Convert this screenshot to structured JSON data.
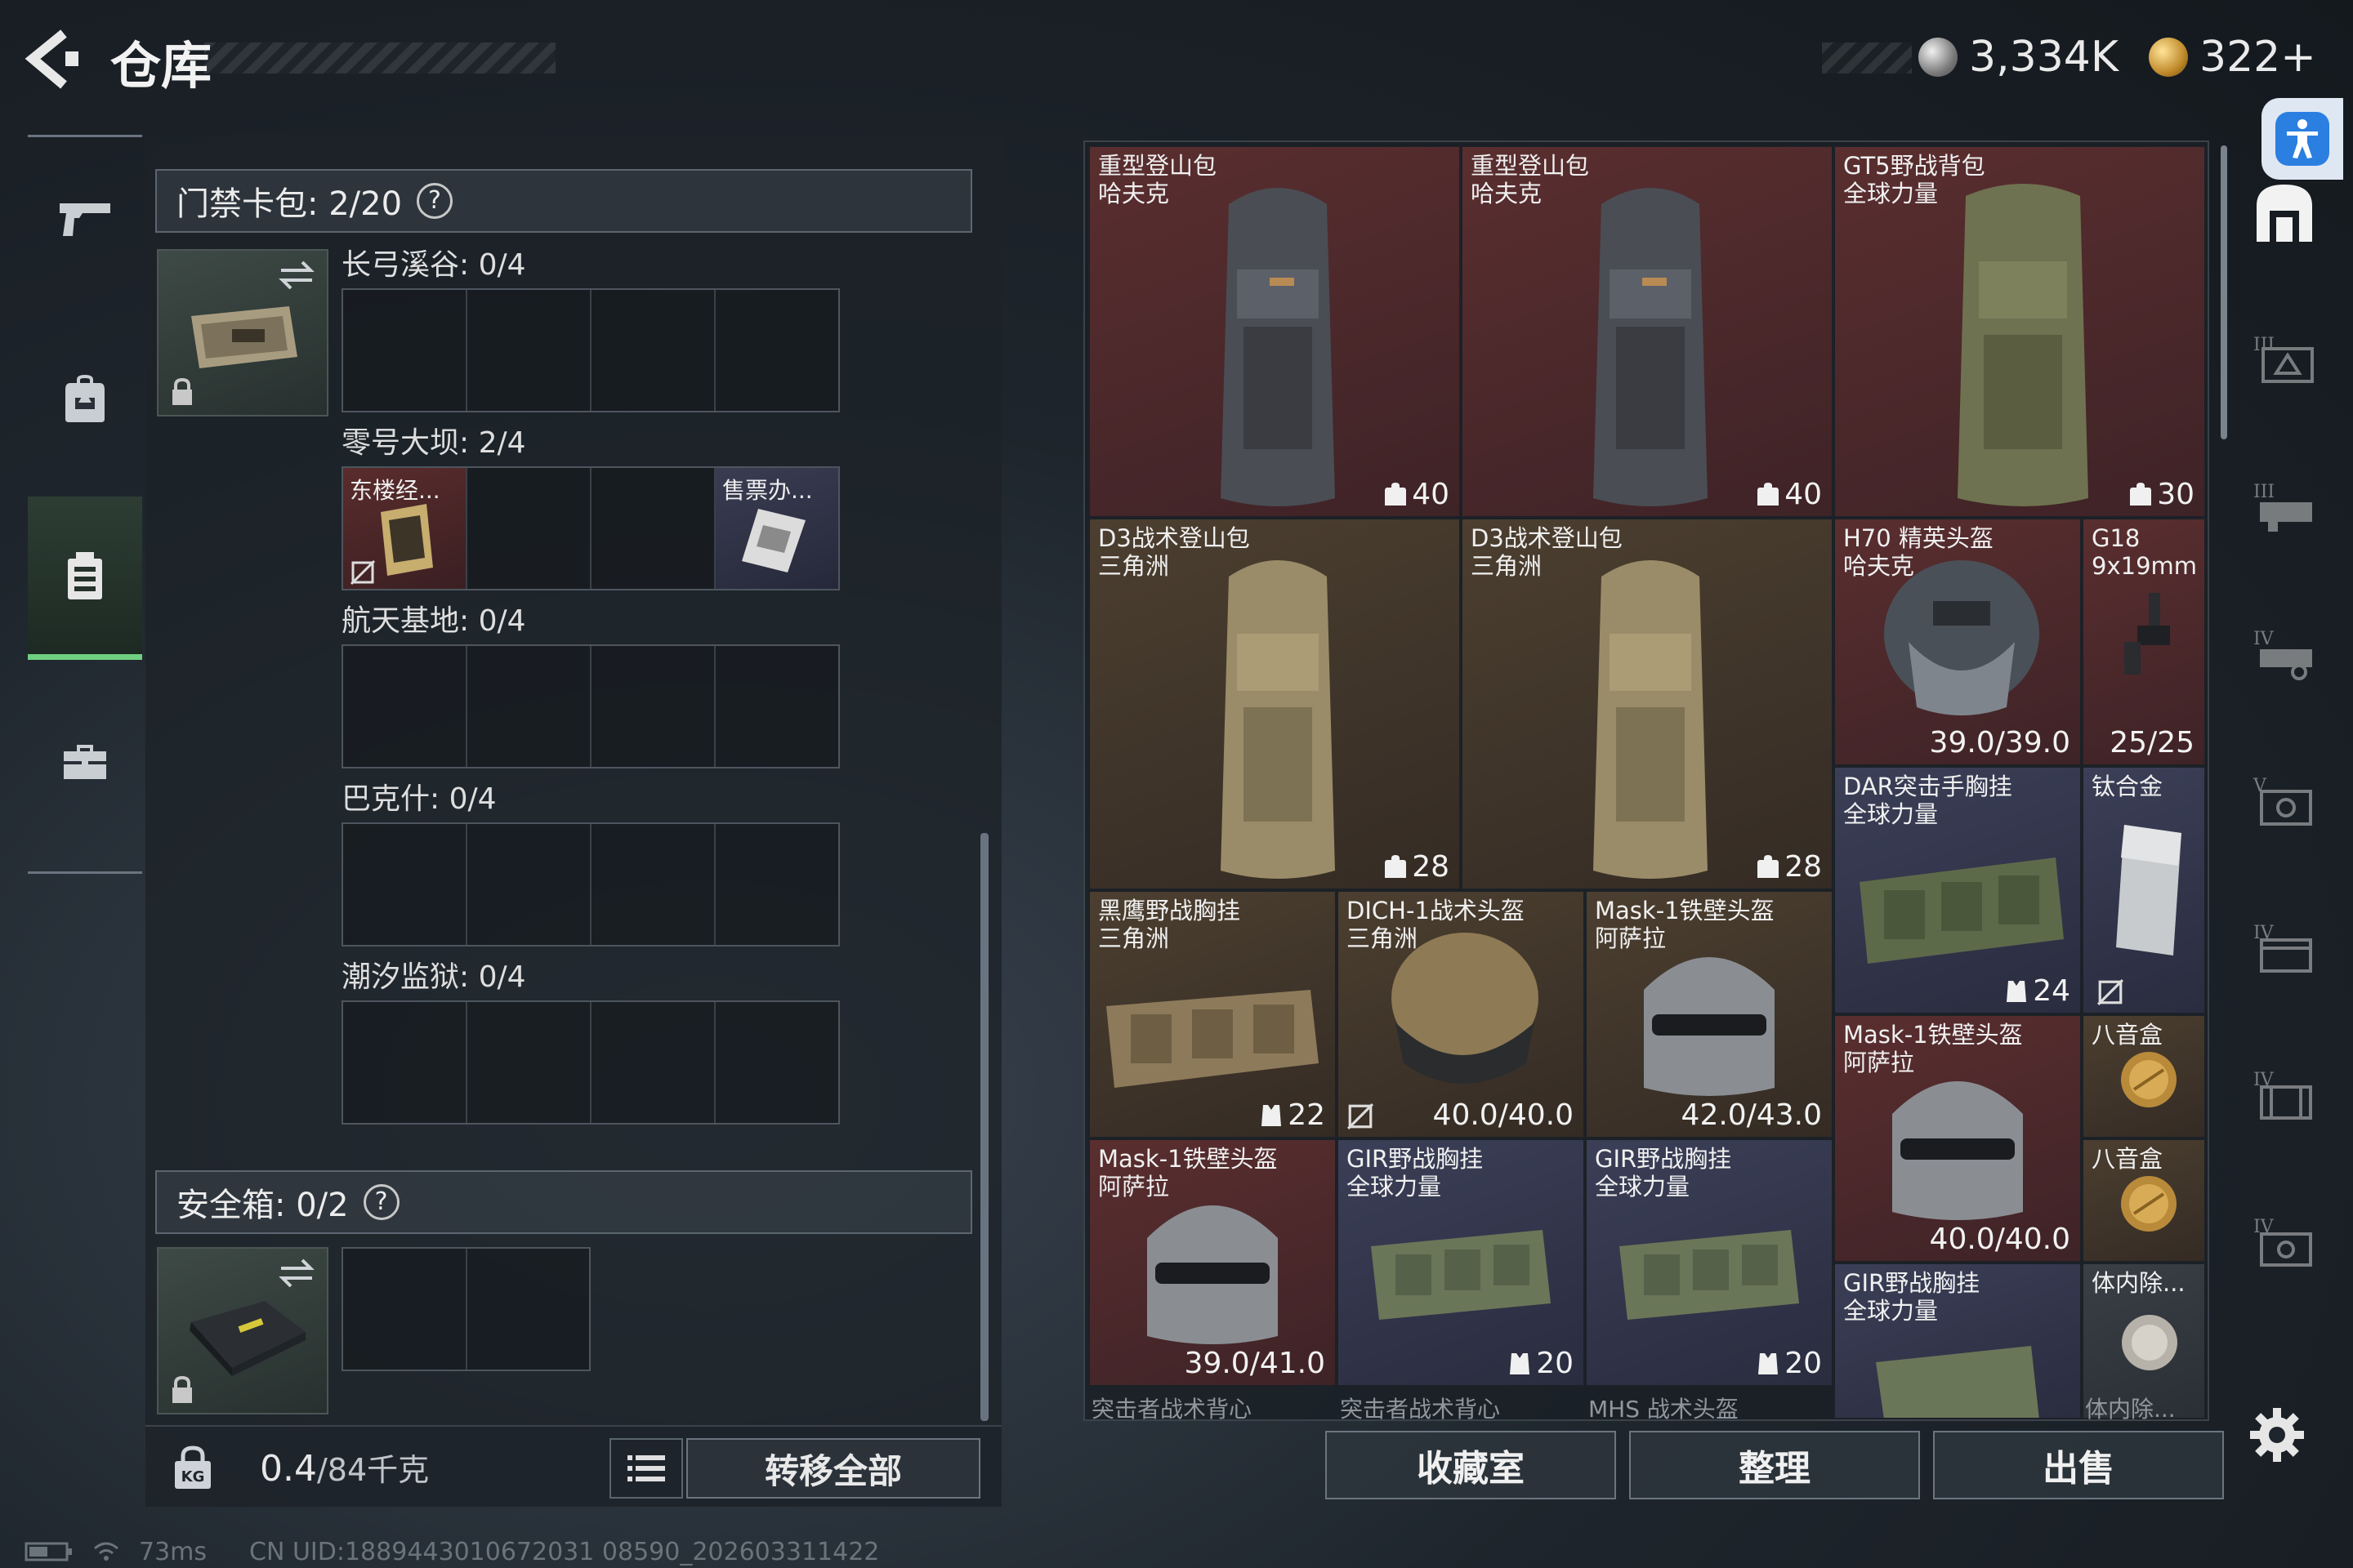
{
  "header": {
    "title": "仓库",
    "currency_silver": "3,334K",
    "currency_gold": "322+"
  },
  "left_panel": {
    "keycard_header": "门禁卡包: 2/20",
    "keycard_help": "?",
    "zones": [
      {
        "label": "长弓溪谷: 0/4"
      },
      {
        "label": "零号大坝: 2/4",
        "items": [
          "东楼经...",
          "售票办..."
        ]
      },
      {
        "label": "航天基地: 0/4"
      },
      {
        "label": "巴克什: 0/4"
      },
      {
        "label": "潮汐监狱: 0/4"
      }
    ],
    "safebox_header": "安全箱: 0/2",
    "safebox_help": "?",
    "weight": "0.4",
    "weight_max": "/84千克",
    "transfer_all": "转移全部"
  },
  "status": {
    "ping": "73ms",
    "uid": "CN UID:1889443010672031 08590_202603311422"
  },
  "grid": {
    "items": [
      {
        "name": "重型登山包",
        "brand": "哈夫克",
        "stat": "40",
        "stat_icon": "backpack"
      },
      {
        "name": "重型登山包",
        "brand": "哈夫克",
        "stat": "40",
        "stat_icon": "backpack"
      },
      {
        "name": "GT5野战背包",
        "brand": "全球力量",
        "stat": "30",
        "stat_icon": "backpack"
      },
      {
        "name": "D3战术登山包",
        "brand": "三角洲",
        "stat": "28",
        "stat_icon": "backpack"
      },
      {
        "name": "D3战术登山包",
        "brand": "三角洲",
        "stat": "28",
        "stat_icon": "backpack"
      },
      {
        "name": "H70 精英头盔",
        "brand": "哈夫克",
        "stat": "39.0/39.0"
      },
      {
        "name": "G18",
        "brand": "9x19mm",
        "stat": "25/25"
      },
      {
        "name": "DAR突击手胸挂",
        "brand": "全球力量",
        "stat": "24",
        "stat_icon": "vest"
      },
      {
        "name": "钛合金",
        "brand": ""
      },
      {
        "name": "黑鹰野战胸挂",
        "brand": "三角洲",
        "stat": "22",
        "stat_icon": "vest"
      },
      {
        "name": "DICH-1战术头盔",
        "brand": "三角洲",
        "stat": "40.0/40.0"
      },
      {
        "name": "Mask-1铁壁头盔",
        "brand": "阿萨拉",
        "stat": "42.0/43.0"
      },
      {
        "name": "Mask-1铁壁头盔",
        "brand": "阿萨拉",
        "stat": "40.0/40.0"
      },
      {
        "name": "八音盒",
        "brand": ""
      },
      {
        "name": "八音盒",
        "brand": ""
      },
      {
        "name": "Mask-1铁壁头盔",
        "brand": "阿萨拉",
        "stat": "39.0/41.0"
      },
      {
        "name": "GIR野战胸挂",
        "brand": "全球力量",
        "stat": "20",
        "stat_icon": "vest"
      },
      {
        "name": "GIR野战胸挂",
        "brand": "全球力量",
        "stat": "20",
        "stat_icon": "vest"
      },
      {
        "name": "GIR野战胸挂",
        "brand": "全球力量"
      },
      {
        "name": "体内除...",
        "brand": ""
      }
    ],
    "partial_row": [
      "突击者战术背心",
      "突击者战术背心",
      "MHS 战术头盔",
      "体内除..."
    ]
  },
  "bottom_buttons": {
    "collection": "收藏室",
    "sort": "整理",
    "sell": "出售"
  },
  "colors": {
    "accent_green": "#6fd081",
    "rarity_red": "#5a2e2f",
    "rarity_blue": "#3b3f57",
    "rarity_gold": "#4c3f30"
  },
  "icons": {
    "left_nav": [
      "pistol-icon",
      "backpack-icon",
      "keycard-case-icon",
      "briefcase-icon"
    ],
    "right_nav": [
      "safehouse-icon",
      "storage-tier-3-icon",
      "storage-tier-3b-icon",
      "storage-tier-4-icon",
      "storage-tier-5-icon",
      "storage-tier-4b-icon",
      "storage-tier-4c-icon",
      "storage-tier-4d-icon"
    ]
  }
}
